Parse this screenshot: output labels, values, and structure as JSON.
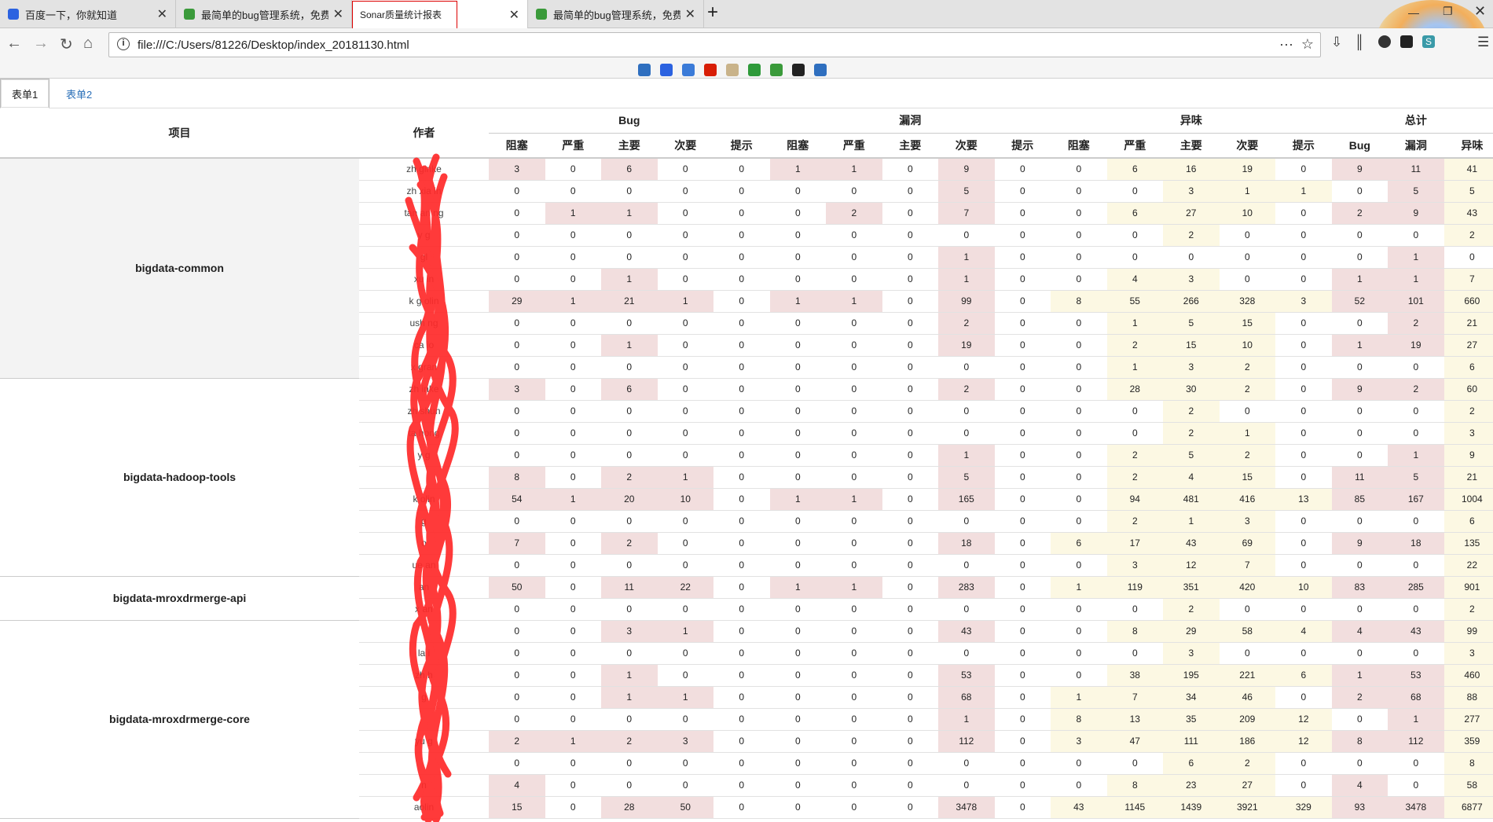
{
  "browser": {
    "tabs": [
      {
        "title": "百度一下，你就知道",
        "favicon_color": "#2b62e0"
      },
      {
        "title": "最简单的bug管理系统，免费石",
        "favicon_color": "#3a9a3a"
      },
      {
        "title": "Sonar质量统计报表",
        "favicon_color": ""
      },
      {
        "title": "最简单的bug管理系统，免费石",
        "favicon_color": "#3a9a3a"
      }
    ],
    "url": "file:///C:/Users/81226/Desktop/index_20181130.html",
    "bookmark_colors": [
      "#2f6fbf",
      "#2b62e0",
      "#3b7bd8",
      "#d81e06",
      "#c9b38a",
      "#2f9a3a",
      "#3a9a3a",
      "#222222",
      "#2f6fbf"
    ]
  },
  "sheets": [
    "表单1",
    "表单2"
  ],
  "table": {
    "col_project": "项目",
    "col_author": "作者",
    "groups": [
      "Bug",
      "漏洞",
      "异味",
      "总计"
    ],
    "sub": [
      "阻塞",
      "严重",
      "主要",
      "次要",
      "提示",
      "阻塞",
      "严重",
      "主要",
      "次要",
      "提示",
      "阻塞",
      "严重",
      "主要",
      "次要",
      "提示",
      "Bug",
      "漏洞",
      "异味"
    ],
    "projects": [
      {
        "name": "bigdata-common",
        "shade": true,
        "rows": [
          {
            "author": "zh   ginke",
            "v": [
              "3",
              "0",
              "6",
              "0",
              "0",
              "1",
              "1",
              "0",
              "9",
              "0",
              "0",
              "6",
              "16",
              "19",
              "0",
              "9",
              "11",
              "41"
            ]
          },
          {
            "author": "zh   xia  in",
            "v": [
              "0",
              "0",
              "0",
              "0",
              "0",
              "0",
              "0",
              "0",
              "5",
              "0",
              "0",
              "0",
              "3",
              "1",
              "1",
              "0",
              "5",
              "5"
            ]
          },
          {
            "author": "tan   an   ng",
            "v": [
              "0",
              "1",
              "1",
              "0",
              "0",
              "0",
              "2",
              "0",
              "7",
              "0",
              "0",
              "6",
              "27",
              "10",
              "0",
              "2",
              "9",
              "43"
            ]
          },
          {
            "author": "y    g",
            "v": [
              "0",
              "0",
              "0",
              "0",
              "0",
              "0",
              "0",
              "0",
              "0",
              "0",
              "0",
              "0",
              "2",
              "0",
              "0",
              "0",
              "0",
              "2"
            ]
          },
          {
            "author": "  gl",
            "v": [
              "0",
              "0",
              "0",
              "0",
              "0",
              "0",
              "0",
              "0",
              "1",
              "0",
              "0",
              "0",
              "0",
              "0",
              "0",
              "0",
              "1",
              "0"
            ]
          },
          {
            "author": "xu    in",
            "v": [
              "0",
              "0",
              "1",
              "0",
              "0",
              "0",
              "0",
              "0",
              "1",
              "0",
              "0",
              "4",
              "3",
              "0",
              "0",
              "1",
              "1",
              "7"
            ]
          },
          {
            "author": "k   g  olin",
            "v": [
              "29",
              "1",
              "21",
              "1",
              "0",
              "1",
              "1",
              "0",
              "99",
              "0",
              "8",
              "55",
              "266",
              "328",
              "3",
              "52",
              "101",
              "660"
            ]
          },
          {
            "author": " ush   ng",
            "v": [
              "0",
              "0",
              "0",
              "0",
              "0",
              "0",
              "0",
              "0",
              "2",
              "0",
              "0",
              "1",
              "5",
              "15",
              "0",
              "0",
              "2",
              "21"
            ]
          },
          {
            "author": "ca   io",
            "v": [
              "0",
              "0",
              "1",
              "0",
              "0",
              "0",
              "0",
              "0",
              "19",
              "0",
              "0",
              "2",
              "15",
              "10",
              "0",
              "1",
              "19",
              "27"
            ]
          },
          {
            "author": "x    gran",
            "v": [
              "0",
              "0",
              "0",
              "0",
              "0",
              "0",
              "0",
              "0",
              "0",
              "0",
              "0",
              "1",
              "3",
              "2",
              "0",
              "0",
              "0",
              "6"
            ]
          }
        ]
      },
      {
        "name": "bigdata-hadoop-tools",
        "shade": false,
        "rows": [
          {
            "author": "zh   inke",
            "v": [
              "3",
              "0",
              "6",
              "0",
              "0",
              "0",
              "0",
              "0",
              "2",
              "0",
              "0",
              "28",
              "30",
              "2",
              "0",
              "9",
              "2",
              "60"
            ]
          },
          {
            "author": "zh   shun",
            "v": [
              "0",
              "0",
              "0",
              "0",
              "0",
              "0",
              "0",
              "0",
              "0",
              "0",
              "0",
              "0",
              "2",
              "0",
              "0",
              "0",
              "0",
              "2"
            ]
          },
          {
            "author": "ta    hong",
            "v": [
              "0",
              "0",
              "0",
              "0",
              "0",
              "0",
              "0",
              "0",
              "0",
              "0",
              "0",
              "0",
              "2",
              "1",
              "0",
              "0",
              "0",
              "3"
            ]
          },
          {
            "author": "y   g",
            "v": [
              "0",
              "0",
              "0",
              "0",
              "0",
              "0",
              "0",
              "0",
              "1",
              "0",
              "0",
              "2",
              "5",
              "2",
              "0",
              "0",
              "1",
              "9"
            ]
          },
          {
            "author": "",
            "v": [
              "8",
              "0",
              "2",
              "1",
              "0",
              "0",
              "0",
              "0",
              "5",
              "0",
              "0",
              "2",
              "4",
              "15",
              "0",
              "11",
              "5",
              "21"
            ]
          },
          {
            "author": "k    olin",
            "v": [
              "54",
              "1",
              "20",
              "10",
              "0",
              "1",
              "1",
              "0",
              "165",
              "0",
              "0",
              "94",
              "481",
              "416",
              "13",
              "85",
              "167",
              "1004"
            ]
          },
          {
            "author": "    g",
            "v": [
              "0",
              "0",
              "0",
              "0",
              "0",
              "0",
              "0",
              "0",
              "0",
              "0",
              "0",
              "2",
              "1",
              "3",
              "0",
              "0",
              "0",
              "6"
            ]
          },
          {
            "author": "    o",
            "v": [
              "7",
              "0",
              "2",
              "0",
              "0",
              "0",
              "0",
              "0",
              "18",
              "0",
              "6",
              "17",
              "43",
              "69",
              "0",
              "9",
              "18",
              "135"
            ]
          },
          {
            "author": "ue   an",
            "v": [
              "0",
              "0",
              "0",
              "0",
              "0",
              "0",
              "0",
              "0",
              "0",
              "0",
              "0",
              "3",
              "12",
              "7",
              "0",
              "0",
              "0",
              "22"
            ]
          }
        ]
      },
      {
        "name": "bigdata-mroxdrmerge-api",
        "shade": false,
        "rows": [
          {
            "author": "    an",
            "v": [
              "50",
              "0",
              "11",
              "22",
              "0",
              "1",
              "1",
              "0",
              "283",
              "0",
              "1",
              "119",
              "351",
              "420",
              "10",
              "83",
              "285",
              "901"
            ]
          },
          {
            "author": "x    an",
            "v": [
              "0",
              "0",
              "0",
              "0",
              "0",
              "0",
              "0",
              "0",
              "0",
              "0",
              "0",
              "0",
              "2",
              "0",
              "0",
              "0",
              "0",
              "2"
            ]
          }
        ]
      },
      {
        "name": "bigdata-mroxdrmerge-core",
        "shade": false,
        "rows": [
          {
            "author": "",
            "v": [
              "0",
              "0",
              "3",
              "1",
              "0",
              "0",
              "0",
              "0",
              "43",
              "0",
              "0",
              "8",
              "29",
              "58",
              "4",
              "4",
              "43",
              "99"
            ]
          },
          {
            "author": "la   i",
            "v": [
              "0",
              "0",
              "0",
              "0",
              "0",
              "0",
              "0",
              "0",
              "0",
              "0",
              "0",
              "0",
              "3",
              "0",
              "0",
              "0",
              "0",
              "3"
            ]
          },
          {
            "author": "zh    h",
            "v": [
              "0",
              "0",
              "1",
              "0",
              "0",
              "0",
              "0",
              "0",
              "53",
              "0",
              "0",
              "38",
              "195",
              "221",
              "6",
              "1",
              "53",
              "460"
            ]
          },
          {
            "author": "    g",
            "v": [
              "0",
              "0",
              "1",
              "1",
              "0",
              "0",
              "0",
              "0",
              "68",
              "0",
              "1",
              "7",
              "34",
              "46",
              "0",
              "2",
              "68",
              "88"
            ]
          },
          {
            "author": "",
            "v": [
              "0",
              "0",
              "0",
              "0",
              "0",
              "0",
              "0",
              "0",
              "1",
              "0",
              "8",
              "13",
              "35",
              "209",
              "12",
              "0",
              "1",
              "277"
            ]
          },
          {
            "author": "yu    g",
            "v": [
              "2",
              "1",
              "2",
              "3",
              "0",
              "0",
              "0",
              "0",
              "112",
              "0",
              "3",
              "47",
              "111",
              "186",
              "12",
              "8",
              "112",
              "359"
            ]
          },
          {
            "author": "",
            "v": [
              "0",
              "0",
              "0",
              "0",
              "0",
              "0",
              "0",
              "0",
              "0",
              "0",
              "0",
              "0",
              "6",
              "2",
              "0",
              "0",
              "0",
              "8"
            ]
          },
          {
            "author": "    n",
            "v": [
              "4",
              "0",
              "0",
              "0",
              "0",
              "0",
              "0",
              "0",
              "0",
              "0",
              "0",
              "8",
              "23",
              "27",
              "0",
              "4",
              "0",
              "58"
            ]
          },
          {
            "author": "    aolin",
            "v": [
              "15",
              "0",
              "28",
              "50",
              "0",
              "0",
              "0",
              "0",
              "3478",
              "0",
              "43",
              "1145",
              "1439",
              "3921",
              "329",
              "93",
              "3478",
              "6877"
            ]
          }
        ]
      }
    ]
  }
}
